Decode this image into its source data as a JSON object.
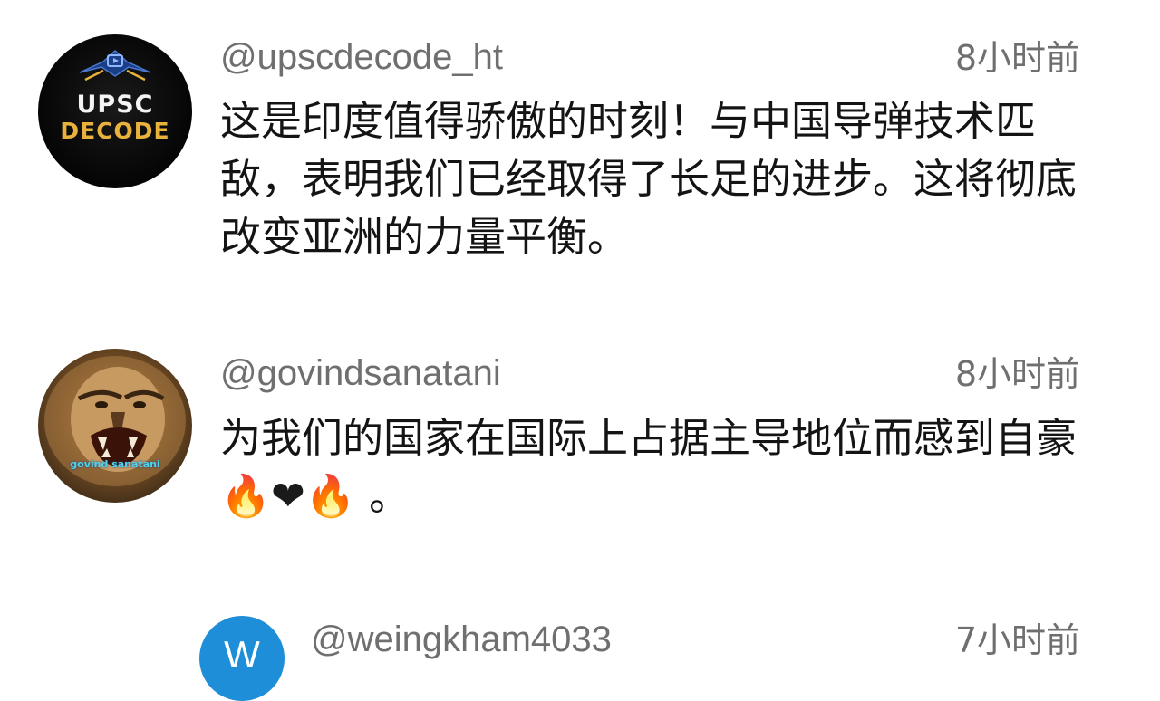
{
  "comments": [
    {
      "username": "@upscdecode_ht",
      "time": "8小时前",
      "text": "这是印度值得骄傲的时刻！与中国导弹技术匹敌，表明我们已经取得了长足的进步。这将彻底改变亚洲的力量平衡。",
      "avatar": {
        "line1": "UPSC",
        "line2": "DECODE"
      }
    },
    {
      "username": "@govindsanatani",
      "time": "8小时前",
      "text_main": "为我们的国家在国际上占据主导地位而感到自豪",
      "emoji": [
        "🔥",
        "❤",
        "🔥"
      ],
      "text_end": "。",
      "avatar": {
        "caption": "govind sanatani"
      }
    },
    {
      "username": "@weingkham4033",
      "time": "7小时前",
      "avatar": {
        "letter": "W",
        "color": "#1f8ed8"
      }
    }
  ],
  "colors": {
    "meta_text": "#6f6f6f",
    "body_text": "#141414",
    "background": "#ffffff"
  }
}
